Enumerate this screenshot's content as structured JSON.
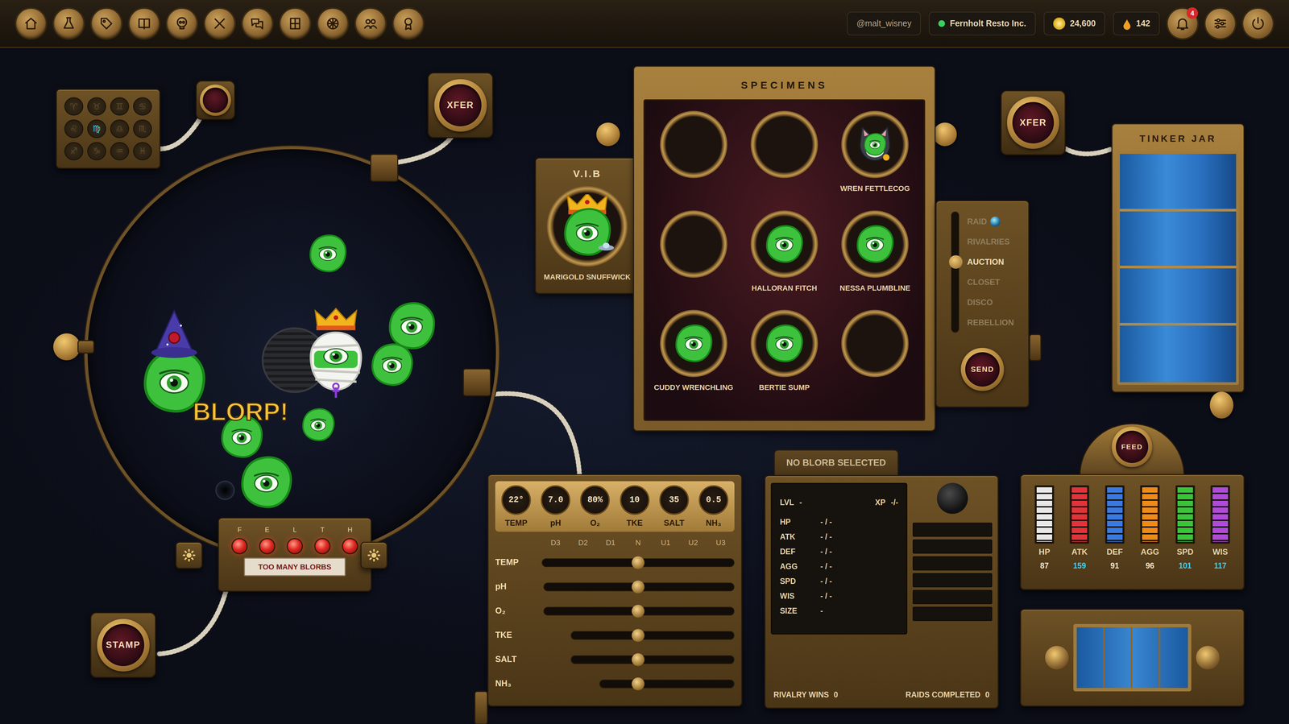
{
  "topbar": {
    "nav": [
      {
        "selected": false
      },
      {
        "selected": false
      },
      {
        "selected": false
      },
      {
        "selected": false
      },
      {
        "selected": false
      },
      {
        "selected": false
      },
      {
        "selected": false
      },
      {
        "selected": false
      },
      {
        "selected": false
      },
      {
        "selected": false
      },
      {
        "selected": false
      }
    ],
    "user": "@malt_wisney",
    "company": {
      "name": "Fernholt Resto Inc.",
      "online": true
    },
    "coins": "24,600",
    "drops": "142",
    "notifications": "4"
  },
  "keypad": {
    "keys": [
      {
        "glyph": "♈",
        "selected": false
      },
      {
        "glyph": "♉",
        "selected": false
      },
      {
        "glyph": "♊",
        "selected": false
      },
      {
        "glyph": "♋",
        "selected": false
      },
      {
        "glyph": "♌",
        "selected": false
      },
      {
        "glyph": "♍",
        "selected": true
      },
      {
        "glyph": "♎",
        "selected": false
      },
      {
        "glyph": "♏",
        "selected": false
      },
      {
        "glyph": "♐",
        "selected": false
      },
      {
        "glyph": "♑",
        "selected": false
      },
      {
        "glyph": "♒",
        "selected": false
      },
      {
        "glyph": "♓",
        "selected": false
      }
    ]
  },
  "buttons": {
    "xfer_left": "XFER",
    "xfer_right": "XFER",
    "stamp": "STAMP",
    "send": "SEND",
    "feed": "FEED"
  },
  "tank": {
    "shout": "BLORP!",
    "blorbs": [
      {
        "kind": "plain"
      },
      {
        "kind": "plain"
      },
      {
        "kind": "plain"
      },
      {
        "kind": "king"
      },
      {
        "kind": "wizard"
      },
      {
        "kind": "plain"
      },
      {
        "kind": "plain"
      },
      {
        "kind": "plain"
      }
    ]
  },
  "felth": {
    "lights": [
      {
        "letter": "F",
        "on": true
      },
      {
        "letter": "E",
        "on": true
      },
      {
        "letter": "L",
        "on": true
      },
      {
        "letter": "T",
        "on": true
      },
      {
        "letter": "H",
        "on": true
      }
    ],
    "warning": "TOO MANY BLORBS"
  },
  "vib": {
    "title": "V.I.B",
    "name": "MARIGOLD SNUFFWICK"
  },
  "specimens": {
    "title": "SPECIMENS",
    "slots": [
      {
        "kind": "empty"
      },
      {
        "kind": "empty"
      },
      {
        "kind": "cat",
        "name": "WREN FETTLECOG"
      },
      {
        "kind": "empty"
      },
      {
        "kind": "plain",
        "name": "HALLORAN FITCH"
      },
      {
        "kind": "plain",
        "name": "NESSA PLUMBLINE"
      },
      {
        "kind": "plain",
        "name": "CUDDY WRENCHLING"
      },
      {
        "kind": "plain",
        "name": "BERTIE SUMP"
      },
      {
        "kind": "empty"
      }
    ]
  },
  "actions": {
    "items": [
      {
        "label": "RAID",
        "selected": false
      },
      {
        "label": "RIVALRIES",
        "selected": false
      },
      {
        "label": "AUCTION",
        "selected": true
      },
      {
        "label": "CLOSET",
        "selected": false
      },
      {
        "label": "DISCO",
        "selected": false
      },
      {
        "label": "REBELLION",
        "selected": false
      }
    ]
  },
  "jar": {
    "title": "TINKER JAR",
    "level": 1
  },
  "environment": {
    "gauges": [
      {
        "value": "22°",
        "label": "TEMP"
      },
      {
        "value": "7.0",
        "label": "pH"
      },
      {
        "value": "80%",
        "label": "O₂"
      },
      {
        "value": "10",
        "label": "TKE"
      },
      {
        "value": "35",
        "label": "SALT"
      },
      {
        "value": "0.5",
        "label": "NH₃"
      }
    ],
    "scale": [
      "D3",
      "D2",
      "D1",
      "N",
      "U1",
      "U2",
      "U3"
    ],
    "sliders": [
      {
        "label": "TEMP",
        "level": 0.5
      },
      {
        "label": "pH",
        "level": 0.5
      },
      {
        "label": "O₂",
        "level": 0.5
      },
      {
        "label": "TKE",
        "level": 0.5
      },
      {
        "label": "SALT",
        "level": 0.5
      },
      {
        "label": "NH₃",
        "level": 0.5
      }
    ]
  },
  "stats": {
    "header": "NO BLORB SELECTED",
    "lvl": {
      "label": "LVL",
      "value": "-"
    },
    "xp": {
      "label": "XP",
      "value": "-/-"
    },
    "rows": [
      {
        "label": "HP",
        "value": "- / -"
      },
      {
        "label": "ATK",
        "value": "- / -"
      },
      {
        "label": "DEF",
        "value": "- / -"
      },
      {
        "label": "AGG",
        "value": "- / -"
      },
      {
        "label": "SPD",
        "value": "- / -"
      },
      {
        "label": "WIS",
        "value": "- / -"
      }
    ],
    "size": {
      "label": "SIZE",
      "value": "-"
    },
    "rivalry": {
      "label": "RIVALRY WINS",
      "value": "0"
    },
    "raids": {
      "label": "RAIDS COMPLETED",
      "value": "0"
    },
    "slots": [
      {
        "empty": true
      },
      {
        "empty": true
      },
      {
        "empty": true
      },
      {
        "empty": true
      },
      {
        "empty": true
      },
      {
        "empty": true
      }
    ]
  },
  "feed": {
    "bars": [
      {
        "label": "HP",
        "value": "87",
        "level": 1,
        "color": "#e8e8e8",
        "boosted": false
      },
      {
        "label": "ATK",
        "value": "159",
        "level": 1,
        "color": "#e0343a",
        "boosted": true
      },
      {
        "label": "DEF",
        "value": "91",
        "level": 1,
        "color": "#3a7ae0",
        "boosted": false
      },
      {
        "label": "AGG",
        "value": "96",
        "level": 1,
        "color": "#ee8a1a",
        "boosted": false
      },
      {
        "label": "SPD",
        "value": "101",
        "level": 1,
        "color": "#3ac43a",
        "boosted": true
      },
      {
        "label": "WIS",
        "value": "117",
        "level": 1,
        "color": "#b04ad8",
        "boosted": true
      }
    ]
  }
}
